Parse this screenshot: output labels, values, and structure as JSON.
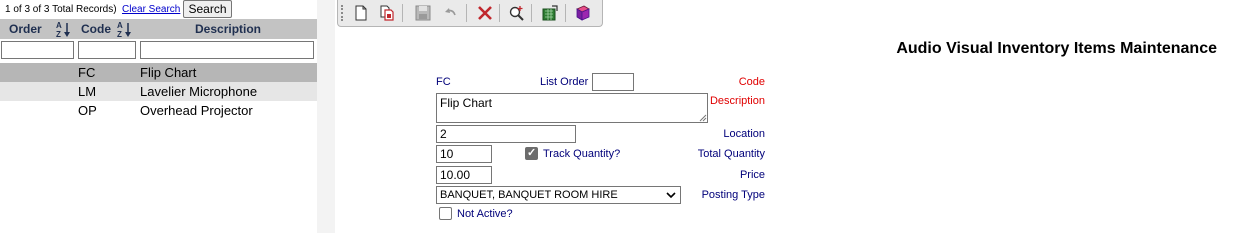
{
  "search_panel": {
    "record_count": "1 of 3 of 3 Total Records)",
    "clear_search": "Clear Search",
    "search_button": "Search",
    "columns": {
      "order": "Order",
      "code": "Code",
      "description": "Description"
    },
    "rows": [
      {
        "order": "",
        "code": "FC",
        "description": "Flip Chart",
        "selected": true
      },
      {
        "order": "",
        "code": "LM",
        "description": "Lavelier Microphone"
      },
      {
        "order": "",
        "code": "OP",
        "description": "Overhead Projector"
      }
    ]
  },
  "toolbar": {
    "icons": [
      "new-record-icon",
      "copy-record-icon",
      "save-icon",
      "undo-icon",
      "delete-icon",
      "find-icon",
      "export-icon",
      "help-book-icon"
    ]
  },
  "form": {
    "title": "Audio Visual Inventory Items Maintenance",
    "code_label": "Code",
    "code_value": "FC",
    "list_order_label": "List Order",
    "list_order_value": "",
    "description_label": "Description",
    "description_value": "Flip Chart",
    "location_label": "Location",
    "location_value": "2",
    "total_quantity_label": "Total Quantity",
    "total_quantity_value": "10",
    "track_quantity_label": "Track Quantity?",
    "track_quantity_checked": true,
    "price_label": "Price",
    "price_value": "10.00",
    "posting_type_label": "Posting Type",
    "posting_type_value": "BANQUET, BANQUET ROOM HIRE",
    "not_active_label": "Not Active?",
    "not_active_checked": false
  }
}
